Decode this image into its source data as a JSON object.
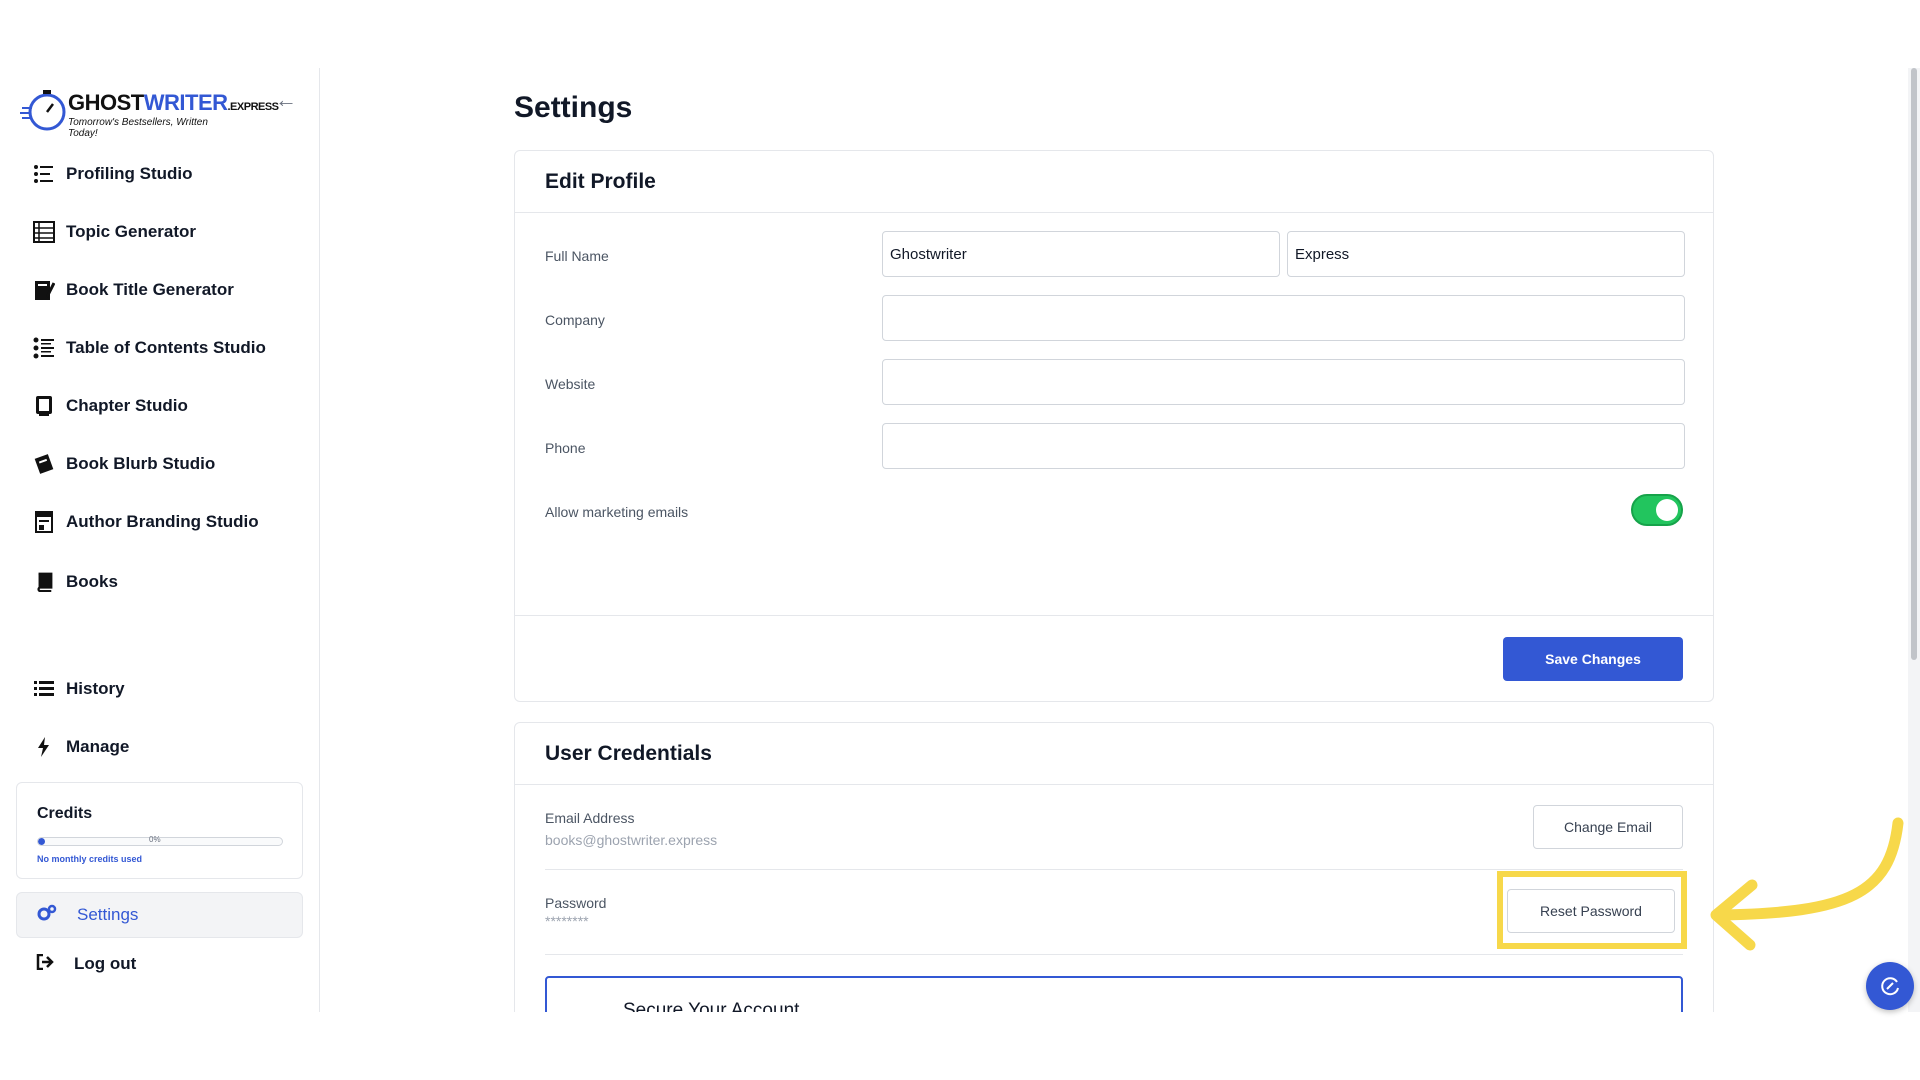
{
  "sidebar": {
    "logo": {
      "brand_part1": "GHOST",
      "brand_part2": "WRITER",
      "brand_suffix": ".EXPRESS",
      "tagline": "Tomorrow's Bestsellers, Written Today!"
    },
    "nav_items": [
      {
        "label": "Profiling Studio",
        "icon": "profiling-list-icon"
      },
      {
        "label": "Topic Generator",
        "icon": "topic-list-icon"
      },
      {
        "label": "Book Title Generator",
        "icon": "book-pen-icon"
      },
      {
        "label": "Table of Contents Studio",
        "icon": "toc-list-icon"
      },
      {
        "label": "Chapter Studio",
        "icon": "chapter-book-icon"
      },
      {
        "label": "Book Blurb Studio",
        "icon": "blurb-books-icon"
      },
      {
        "label": "Author Branding Studio",
        "icon": "branding-page-icon"
      },
      {
        "label": "Books",
        "icon": "book-icon"
      },
      {
        "label": "History",
        "icon": "history-list-icon"
      },
      {
        "label": "Manage",
        "icon": "lightning-icon"
      }
    ],
    "credits": {
      "title": "Credits",
      "percent_label": "0%",
      "used_fraction": 0.03,
      "note": "No monthly credits used"
    },
    "settings": {
      "label": "Settings",
      "icon": "gears-icon"
    },
    "logout": {
      "label": "Log out",
      "icon": "logout-icon"
    }
  },
  "main": {
    "title": "Settings",
    "edit_profile": {
      "heading": "Edit Profile",
      "full_name_label": "Full Name",
      "first_name_value": "Ghostwriter",
      "last_name_value": "Express",
      "company_label": "Company",
      "company_value": "",
      "website_label": "Website",
      "website_value": "",
      "phone_label": "Phone",
      "phone_value": "",
      "marketing_label": "Allow marketing emails",
      "marketing_enabled": true,
      "save_label": "Save Changes"
    },
    "credentials": {
      "heading": "User Credentials",
      "email_label": "Email Address",
      "email_value": "books@ghostwriter.express",
      "change_email_label": "Change Email",
      "password_label": "Password",
      "password_value": "********",
      "reset_password_label": "Reset Password",
      "secure_title": "Secure Your Account"
    }
  },
  "colors": {
    "accent": "#3358d4",
    "toggle_on": "#22c55e",
    "highlight": "#f7d84a"
  }
}
